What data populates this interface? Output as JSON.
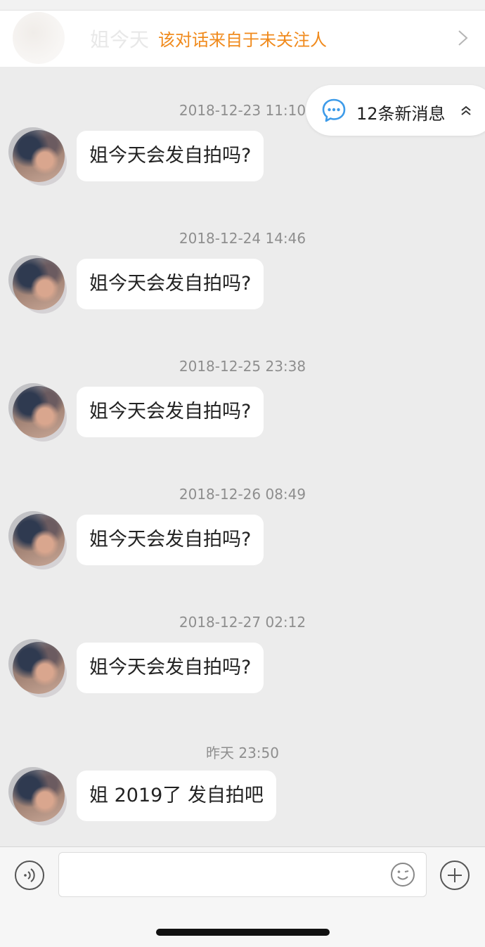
{
  "banner": {
    "ghost_text": "姐今天",
    "text": "该对话来自于未关注人",
    "text_color": "#f08a1c"
  },
  "new_messages": {
    "label": "12条新消息",
    "icon": "chat-bubble-icon",
    "accent": "#3d9be9"
  },
  "messages": [
    {
      "timestamp": "2018-12-23 11:10",
      "text": "姐今天会发自拍吗?"
    },
    {
      "timestamp": "2018-12-24 14:46",
      "text": "姐今天会发自拍吗?"
    },
    {
      "timestamp": "2018-12-25 23:38",
      "text": "姐今天会发自拍吗?"
    },
    {
      "timestamp": "2018-12-26 08:49",
      "text": "姐今天会发自拍吗?"
    },
    {
      "timestamp": "2018-12-27 02:12",
      "text": "姐今天会发自拍吗?"
    },
    {
      "timestamp": "昨天 23:50",
      "text": "姐 2019了 发自拍吧"
    }
  ],
  "input_bar": {
    "placeholder": "",
    "voice_icon": "voice-icon",
    "emoji_icon": "emoji-icon",
    "plus_icon": "plus-icon"
  }
}
